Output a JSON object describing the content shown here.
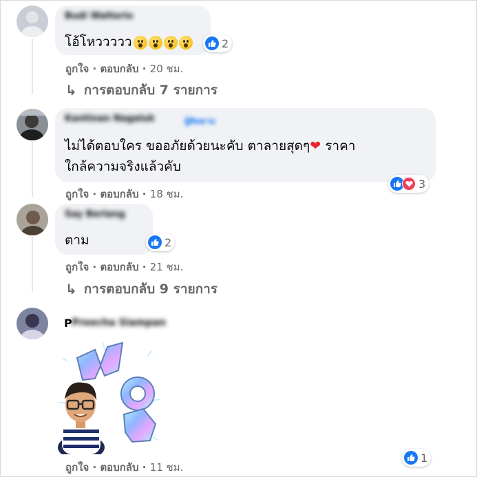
{
  "comments": [
    {
      "author": "Budi Walterio",
      "text": "โอ้โหววววว",
      "emoji_count": 4,
      "reaction_count": "2",
      "like_label": "ถูกใจ",
      "reply_label": "ตอบกลับ",
      "time": "20 ชม.",
      "replies_label": "การตอบกลับ 7 รายการ"
    },
    {
      "author": "Kantinan Nagaluk",
      "author_tag": "ผู้ติดตาม",
      "text_line1a": "ไม่ได้ตอบใคร ขออภัยด้วยนะคับ ตาลายสุดๆ",
      "text_line1b": " ราคา",
      "text_line2": "ใกล้ความจริงแล้วคับ",
      "reaction_count": "3",
      "like_label": "ถูกใจ",
      "reply_label": "ตอบกลับ",
      "time": "18 ชม."
    },
    {
      "author": "Say Berlang",
      "text": "ตาม",
      "reaction_count": "2",
      "like_label": "ถูกใจ",
      "reply_label": "ตอบกลับ",
      "time": "21 ชม.",
      "replies_label": "การตอบกลับ 9 รายการ"
    },
    {
      "author_initial": "P",
      "author": "Preecha Siampan",
      "sticker": "wow-sticker",
      "reaction_count": "1",
      "like_label": "ถูกใจ",
      "reply_label": "ตอบกลับ",
      "time": "11 ชม."
    }
  ],
  "separator": "·",
  "colors": {
    "bubble": "#f0f2f5",
    "secondary_text": "#65676b",
    "like_blue": "#1877f2",
    "love_red": "#f33e58"
  },
  "icons": [
    "like-icon",
    "love-icon",
    "reply-arrow-icon",
    "wow-emoji-icon",
    "heart-icon"
  ]
}
